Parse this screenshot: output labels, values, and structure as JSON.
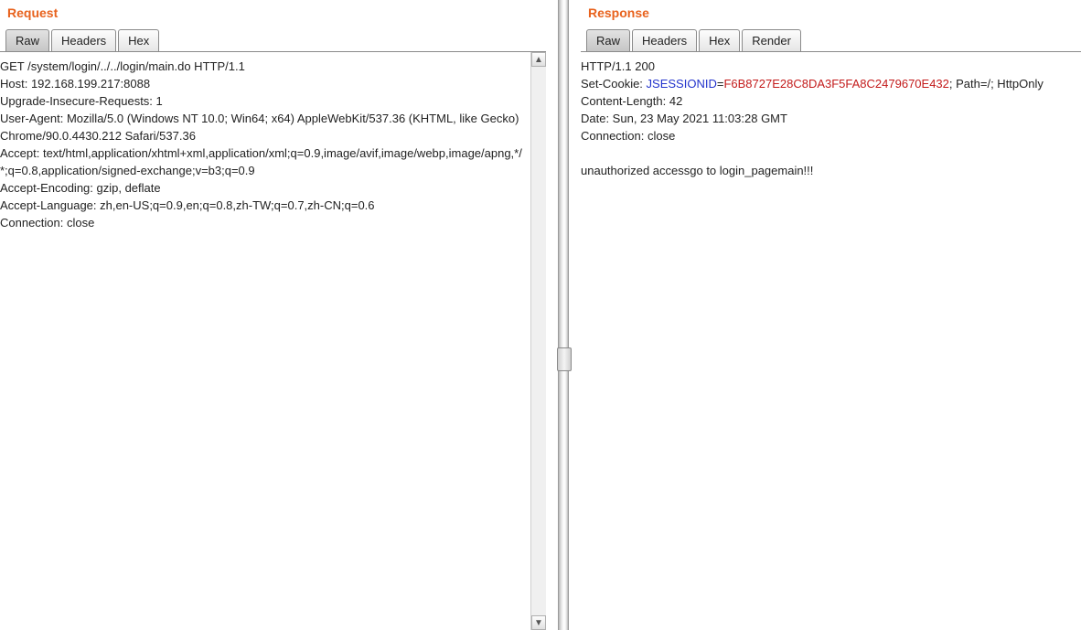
{
  "request": {
    "title": "Request",
    "tabs": {
      "raw": "Raw",
      "headers": "Headers",
      "hex": "Hex"
    },
    "lines": [
      "GET /system/login/../../login/main.do HTTP/1.1",
      "Host: 192.168.199.217:8088",
      "Upgrade-Insecure-Requests: 1",
      "User-Agent: Mozilla/5.0 (Windows NT 10.0; Win64; x64) AppleWebKit/537.36 (KHTML, like Gecko) Chrome/90.0.4430.212 Safari/537.36",
      "Accept: text/html,application/xhtml+xml,application/xml;q=0.9,image/avif,image/webp,image/apng,*/*;q=0.8,application/signed-exchange;v=b3;q=0.9",
      "Accept-Encoding: gzip, deflate",
      "Accept-Language: zh,en-US;q=0.9,en;q=0.8,zh-TW;q=0.7,zh-CN;q=0.6",
      "Connection: close"
    ]
  },
  "response": {
    "title": "Response",
    "tabs": {
      "raw": "Raw",
      "headers": "Headers",
      "hex": "Hex",
      "render": "Render"
    },
    "status_line": "HTTP/1.1 200",
    "set_cookie_prefix": "Set-Cookie: ",
    "cookie_name": "JSESSIONID",
    "cookie_eq": "=",
    "cookie_value": "F6B8727E28C8DA3F5FA8C2479670E432",
    "cookie_suffix": "; Path=/; HttpOnly",
    "content_length": "Content-Length: 42",
    "date": "Date: Sun, 23 May 2021 11:03:28 GMT",
    "connection": "Connection: close",
    "body": "unauthorized accessgo to login_pagemain!!!"
  }
}
